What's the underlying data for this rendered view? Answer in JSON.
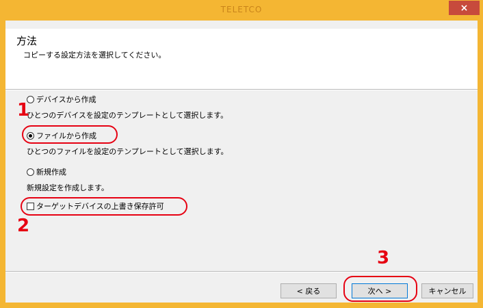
{
  "window": {
    "title": "TELETCO",
    "close_glyph": "×"
  },
  "header": {
    "title": "方法",
    "subtitle": "コピーする設定方法を選択してください。"
  },
  "options": [
    {
      "label": "デバイスから作成",
      "description": "ひとつのデバイスを設定のテンプレートとして選択します。",
      "selected": false
    },
    {
      "label": "ファイルから作成",
      "description": "ひとつのファイルを設定のテンプレートとして選択します。",
      "selected": true
    },
    {
      "label": "新規作成",
      "description": "新規設定を作成します。",
      "selected": false
    }
  ],
  "overwrite_checkbox": {
    "label": "ターゲットデバイスの上書き保存許可",
    "checked": false
  },
  "callouts": {
    "step1": "1",
    "step2": "2",
    "step3": "3",
    "color": "#e60012"
  },
  "buttons": {
    "back": "< 戻る",
    "next": "次へ >",
    "cancel": "キャンセル"
  },
  "colors": {
    "frame": "#f4b633",
    "close": "#c74a3c"
  }
}
